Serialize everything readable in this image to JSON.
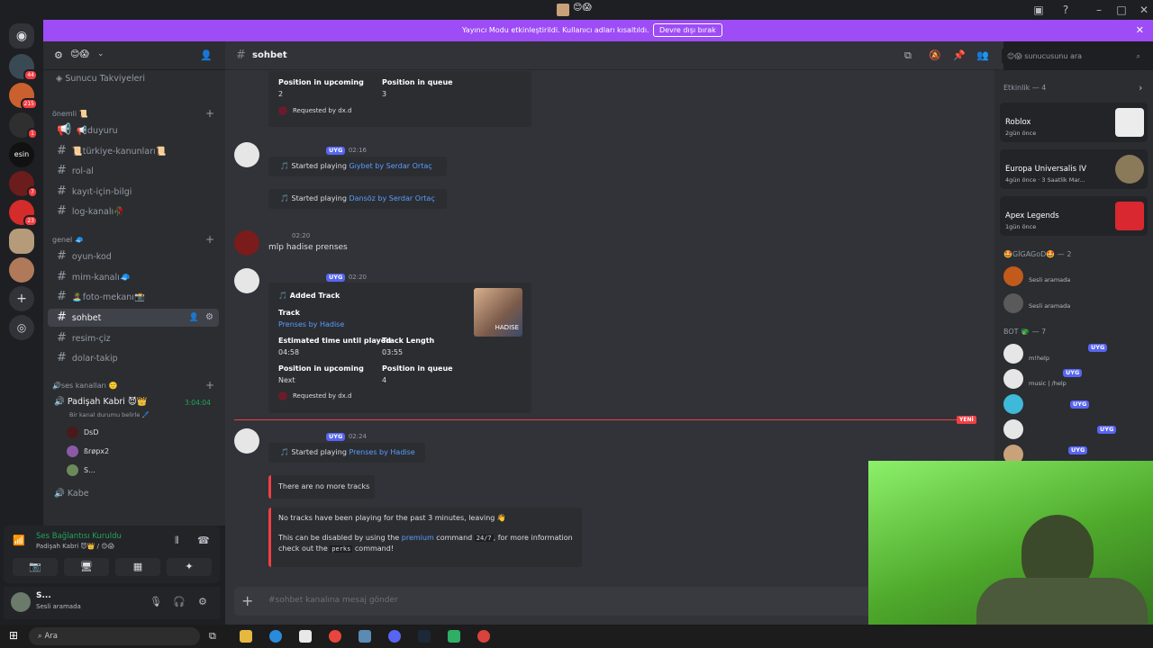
{
  "banner": {
    "text": "Yayıncı Modu etkinleştirildi. Kullanıcı adları kısaltıldı.",
    "button": "Devre dışı bırak"
  },
  "server": {
    "name": "😊😱"
  },
  "sidebar": {
    "boosts": "Sunucu Takviyeleri",
    "cat_onemli": "önemli 📜",
    "cat_genel": "genel 🧢",
    "cat_ses": "🔊ses kanalları 🙂",
    "channels": [
      {
        "label": "📢duyuru"
      },
      {
        "label": "📜türkiye-kanunları📜"
      },
      {
        "label": "rol-al"
      },
      {
        "label": "kayıt-için-bilgi"
      },
      {
        "label": "log-kanalı🥀"
      },
      {
        "label": "oyun-kod"
      },
      {
        "label": "mim-kanalı🧢"
      },
      {
        "label": "🏝️foto-mekanı📸"
      },
      {
        "label": "sohbet"
      },
      {
        "label": "resim-çiz"
      },
      {
        "label": "dolar-takip"
      }
    ],
    "voice": {
      "name": "Padişah Kabri 😈👑",
      "timer": "3:04:04",
      "status": "Bir kanal durumu belirle 🖊️",
      "users": [
        "DsD",
        "ßrøpx2",
        "S..."
      ],
      "kabe": "Kabe"
    }
  },
  "voice_panel": {
    "title": "Ses Bağlantısı Kuruldu",
    "sub": "Padişah Kabri 😈👑 / 😊😱"
  },
  "user": {
    "name": "S...",
    "status": "Sesli aramada"
  },
  "header": {
    "channel": "sohbet",
    "search": "😊😱 sunucusunu ara"
  },
  "messages": {
    "top_embed": {
      "pos_upcoming_label": "Position in upcoming",
      "pos_upcoming": "2",
      "pos_queue_label": "Position in queue",
      "pos_queue": "3",
      "requested": "Requested by dx.d"
    },
    "m1": {
      "tag": "UYG",
      "time": "02:16",
      "started": "Started playing ",
      "track1": "Gıybet by Serdar Ortaç",
      "track2": "Dansöz by Serdar Ortaç"
    },
    "m2": {
      "time": "02:20",
      "text": "mlp hadise prenses"
    },
    "m3": {
      "tag": "UYG",
      "time": "02:20",
      "title": "Added Track",
      "track_label": "Track",
      "track": "Prenses by Hadise",
      "est_label": "Estimated time until played",
      "est": "04:58",
      "len_label": "Track Length",
      "len": "03:55",
      "pos_upcoming_label": "Position in upcoming",
      "pos_upcoming": "Next",
      "pos_queue_label": "Position in queue",
      "pos_queue": "4",
      "requested": "Requested by dx.d",
      "thumb_text": "HADISE"
    },
    "new_label": "YENİ",
    "m4": {
      "tag": "UYG",
      "time": "02:24",
      "started": "Started playing ",
      "track": "Prenses by Hadise",
      "no_more": "There are no more tracks",
      "idle": "No tracks have been playing for the past 3 minutes, leaving 👋",
      "disable_pre": "This can be disabled by using the ",
      "premium": "premium",
      "disable_mid": " command ",
      "cmd": "24/7",
      "disable_post": ", for more information check out the ",
      "perks": "perks",
      "disable_end": " command!"
    }
  },
  "composer": {
    "placeholder": "#sohbet kanalına mesaj gönder"
  },
  "members": {
    "activity_title": "Etkinlik — 4",
    "activities": [
      {
        "name": "Roblox",
        "sub": "2gün önce"
      },
      {
        "name": "Europa Universalis IV",
        "sub": "4gün önce · 3 Saatlik Mar..."
      },
      {
        "name": "Apex Legends",
        "sub": "1gün önce"
      }
    ],
    "group1": "🤩GİGAGoD🤩 — 2",
    "g1_status": "Sesli aramada",
    "group2": "BOT 🐲 — 7",
    "bots": [
      {
        "tag": "UYG",
        "status": "m!help"
      },
      {
        "tag": "UYG",
        "status": "music | /help"
      },
      {
        "tag": "UYG",
        "status": ""
      },
      {
        "tag": "UYG",
        "status": ""
      },
      {
        "tag": "UYG",
        "status": ""
      }
    ]
  },
  "taskbar": {
    "search": "Ara"
  }
}
